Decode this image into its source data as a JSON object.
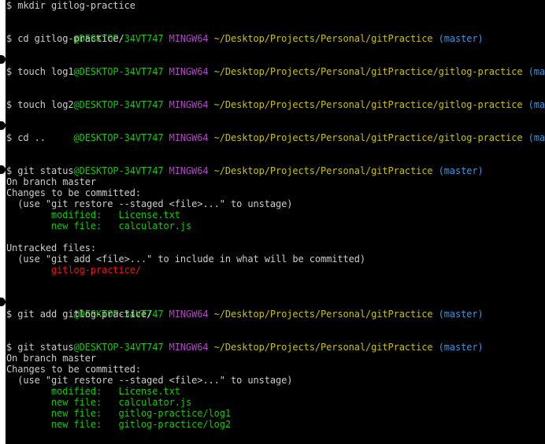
{
  "terminal": {
    "colors": {
      "background": "#000000",
      "text": "#cccccc",
      "user_host": "#16c60c",
      "mingw": "#b148c6",
      "path": "#c9c10c",
      "branch": "#3a96dd",
      "staged": "#16c60c",
      "untracked": "#e01818"
    },
    "prompt": {
      "host": "@DESKTOP-34VT747",
      "shell": "MINGW64",
      "branch": "(master)",
      "path_root": "~/Desktop/Projects/Personal/gitPractice",
      "path_sub": "~/Desktop/Projects/Personal/gitPractice/gitlog-practice"
    },
    "commands": {
      "c1": "$ mkdir gitlog-practice",
      "c2": "$ cd gitlog-practice/",
      "c3": "$ touch log1",
      "c4": "$ touch log2",
      "c5": "$ cd ..",
      "c6": "$ git status",
      "c7": "$ git add gitlog-practice/",
      "c8": "$ git status"
    },
    "status1": {
      "branch_line": "On branch master",
      "changes_header": "Changes to be committed:",
      "hint": "  (use \"git restore --staged <file>...\" to unstage)",
      "entries": [
        {
          "kind": "        modified:   ",
          "file": "License.txt"
        },
        {
          "kind": "        new file:   ",
          "file": "calculator.js"
        }
      ],
      "untracked_header": "Untracked files:",
      "untracked_hint": "  (use \"git add <file>...\" to include in what will be committed)",
      "untracked_item": "        gitlog-practice/"
    },
    "status2": {
      "branch_line": "On branch master",
      "changes_header": "Changes to be committed:",
      "hint": "  (use \"git restore --staged <file>...\" to unstage)",
      "entries": [
        {
          "kind": "        modified:   ",
          "file": "License.txt"
        },
        {
          "kind": "        new file:   ",
          "file": "calculator.js"
        },
        {
          "kind": "        new file:   ",
          "file": "gitlog-practice/log1"
        },
        {
          "kind": "        new file:   ",
          "file": "gitlog-practice/log2"
        }
      ]
    }
  }
}
